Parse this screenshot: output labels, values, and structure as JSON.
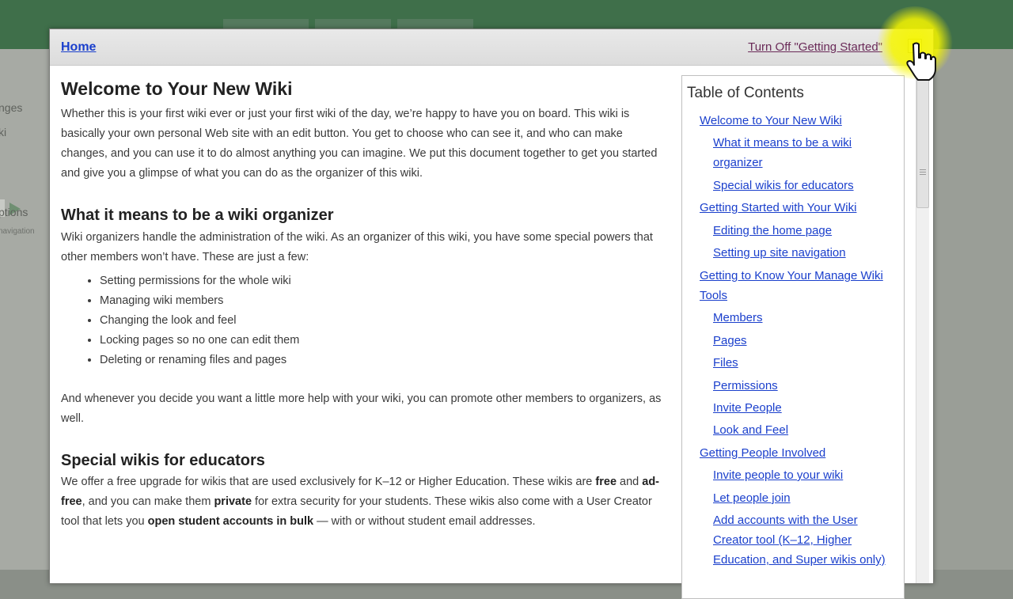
{
  "background": {
    "sidebar_fragments": [
      "nges",
      "ki",
      "ptions",
      "navigation"
    ]
  },
  "header": {
    "home_link": "Home",
    "turn_off_link": "Turn Off \"Getting Started\"",
    "close_label": "✕"
  },
  "content": {
    "h1": "Welcome to Your New Wiki",
    "intro": "Whether this is your first wiki ever or just your first wiki of the day, we’re happy to have you on board. This wiki is basically your own personal Web site with an edit button. You get to choose who can see it, and who can make changes, and you can use it to do almost anything you can imagine. We put this document together to get you started and give you a glimpse of what you can do as the organizer of this wiki.",
    "h2_organizer": "What it means to be a wiki organizer",
    "organizer_p": "Wiki organizers handle the administration of the wiki. As an organizer of this wiki, you have some special powers that other members won’t have. These are just a few:",
    "organizer_list": [
      "Setting permissions for the whole wiki",
      "Managing wiki members",
      "Changing the look and feel",
      "Locking pages so no one can edit them",
      "Deleting or renaming files and pages"
    ],
    "promote_p": "And whenever you decide you want a little more help with your wiki, you can promote other members to organizers, as well.",
    "h2_educators": "Special wikis for educators",
    "edu": {
      "t1": "We offer a free upgrade for wikis that are used exclusively for K–12 or Higher Education. These wikis are ",
      "b1": "free",
      "t2": " and ",
      "b2": "ad-free",
      "t3": ", and you can make them ",
      "b3": "private",
      "t4": " for extra security for your students. These wikis also come with a User Creator tool that lets you ",
      "b4": "open student accounts in bulk",
      "t5": " — with or without student email addresses."
    }
  },
  "toc": {
    "title": "Table of Contents",
    "items": [
      {
        "label": "Welcome to Your New Wiki"
      },
      {
        "label": "What it means to be a wiki organizer"
      },
      {
        "label": "Special wikis for educators"
      },
      {
        "label": "Getting Started with Your Wiki"
      },
      {
        "label": "Editing the home page"
      },
      {
        "label": "Setting up site navigation"
      },
      {
        "label": "Getting to Know Your Manage Wiki Tools"
      },
      {
        "label": "Members"
      },
      {
        "label": "Pages"
      },
      {
        "label": "Files"
      },
      {
        "label": "Permissions"
      },
      {
        "label": "Invite People"
      },
      {
        "label": "Look and Feel"
      },
      {
        "label": "Getting People Involved"
      },
      {
        "label": "Invite people to your wiki"
      },
      {
        "label": "Let people join"
      },
      {
        "label": "Add accounts with the User Creator tool (K–12, Higher Education, and Super wikis only)"
      }
    ]
  },
  "colors": {
    "link": "#1a3fcc",
    "visited_link": "#6a2a58",
    "highlight": "#f6f600"
  }
}
